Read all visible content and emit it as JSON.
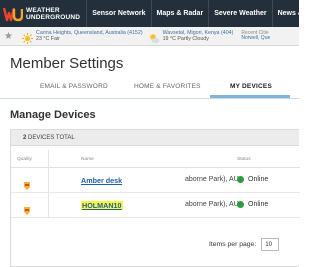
{
  "nav": {
    "logo_line1": "WEATHER",
    "logo_line2": "UNDERGROUND",
    "items": [
      "Sensor Network",
      "Maps & Radar",
      "Severe Weather",
      "News &"
    ]
  },
  "weather_bar": {
    "star_icon": "star-icon",
    "locations": [
      {
        "place": "Carina Heights, Queensland, Australia (4152)",
        "conditions": "23 °C Fair"
      },
      {
        "place": "Wavsetal, Migori, Kenya (404)",
        "conditions": "19 °C Partly Cloudy"
      }
    ],
    "recent_label": "Recent Citie",
    "recent_place": "Norwell, Que"
  },
  "page": {
    "title": "Member Settings",
    "tabs": [
      "EMAIL & PASSWORD",
      "HOME & FAVORITES",
      "MY DEVICES"
    ],
    "active_tab": "MY DEVICES",
    "section_title": "Manage Devices"
  },
  "devices": {
    "total_count": "2",
    "total_label": "DEVICES TOTAL",
    "columns": {
      "quality": "Quality",
      "name": "Name",
      "status": "Status"
    },
    "rows": [
      {
        "name": "Amber desk",
        "location": "aborne Park), AU",
        "status": "Online"
      },
      {
        "name": "HOLMAN10",
        "location": "aborne Park), AU",
        "status": "Online"
      }
    ],
    "pager_label": "Items per page:",
    "pager_value": "10"
  },
  "colors": {
    "nav_bg": "#23303b",
    "link": "#1f5fa8",
    "online": "#2c9a3e",
    "highlight": "#fbf73a",
    "tab_accent": "#7fb6e0"
  }
}
